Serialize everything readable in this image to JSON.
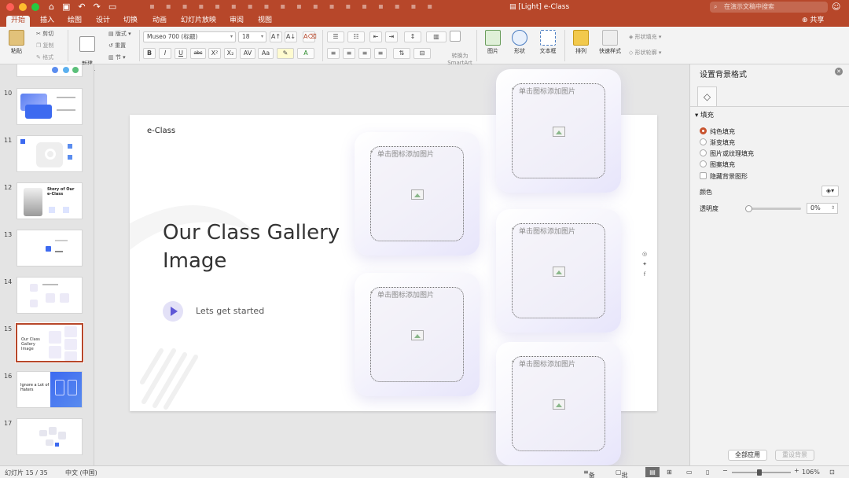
{
  "window": {
    "title": "[Light] e-Class",
    "search_placeholder": "在演示文稿中搜索",
    "share_label": "共享"
  },
  "ribbon_tabs": [
    "开始",
    "插入",
    "绘图",
    "设计",
    "切换",
    "动画",
    "幻灯片放映",
    "审阅",
    "视图"
  ],
  "toolbar": {
    "paste": "粘贴",
    "cut": "剪切",
    "copy": "复制",
    "format": "格式",
    "new_slide": "新建\n幻灯片",
    "layout": "版式",
    "reset": "重置",
    "section": "节",
    "font_name": "Museo 700 (标题)",
    "font_size": "18",
    "convert_smartart": "转换为\nSmartArt",
    "picture": "图片",
    "shapes": "形状",
    "textbox": "文本框",
    "arrange": "排列",
    "quick_styles": "快速样式",
    "shape_fill": "形状填充",
    "shape_outline": "形状轮廓"
  },
  "thumbnails": [
    {
      "num": "10",
      "text": ""
    },
    {
      "num": "11",
      "text": ""
    },
    {
      "num": "12",
      "text": "Story of Our e-Class"
    },
    {
      "num": "13",
      "text": ""
    },
    {
      "num": "14",
      "text": ""
    },
    {
      "num": "15",
      "text": "Our Class Gallery Image",
      "selected": true
    },
    {
      "num": "16",
      "text": "Ignore a Lot of Haters"
    },
    {
      "num": "17",
      "text": ""
    }
  ],
  "slide": {
    "logo": "e-Class",
    "headline": "Our Class Gallery Image",
    "cta": "Lets get started",
    "placeholder_label": "单击图标添加图片",
    "social_icons": [
      "instagram-icon",
      "twitter-icon",
      "facebook-icon"
    ]
  },
  "format_pane": {
    "title": "设置背景格式",
    "section": "填充",
    "options": [
      "纯色填充",
      "渐变填充",
      "图片或纹理填充",
      "图案填充"
    ],
    "selected_option": "纯色填充",
    "hide_graphics": "隐藏背景图形",
    "color_label": "颜色",
    "transparency_label": "透明度",
    "transparency_value": "0%",
    "apply_all": "全部应用",
    "reset_bg": "重设背景"
  },
  "status": {
    "slide_counter": "幻灯片 15 / 35",
    "language": "中文 (中国)",
    "notes": "备注",
    "comments": "批注",
    "zoom": "106%"
  },
  "colors": {
    "accent": "#b7472a",
    "play": "#5e57d6"
  }
}
